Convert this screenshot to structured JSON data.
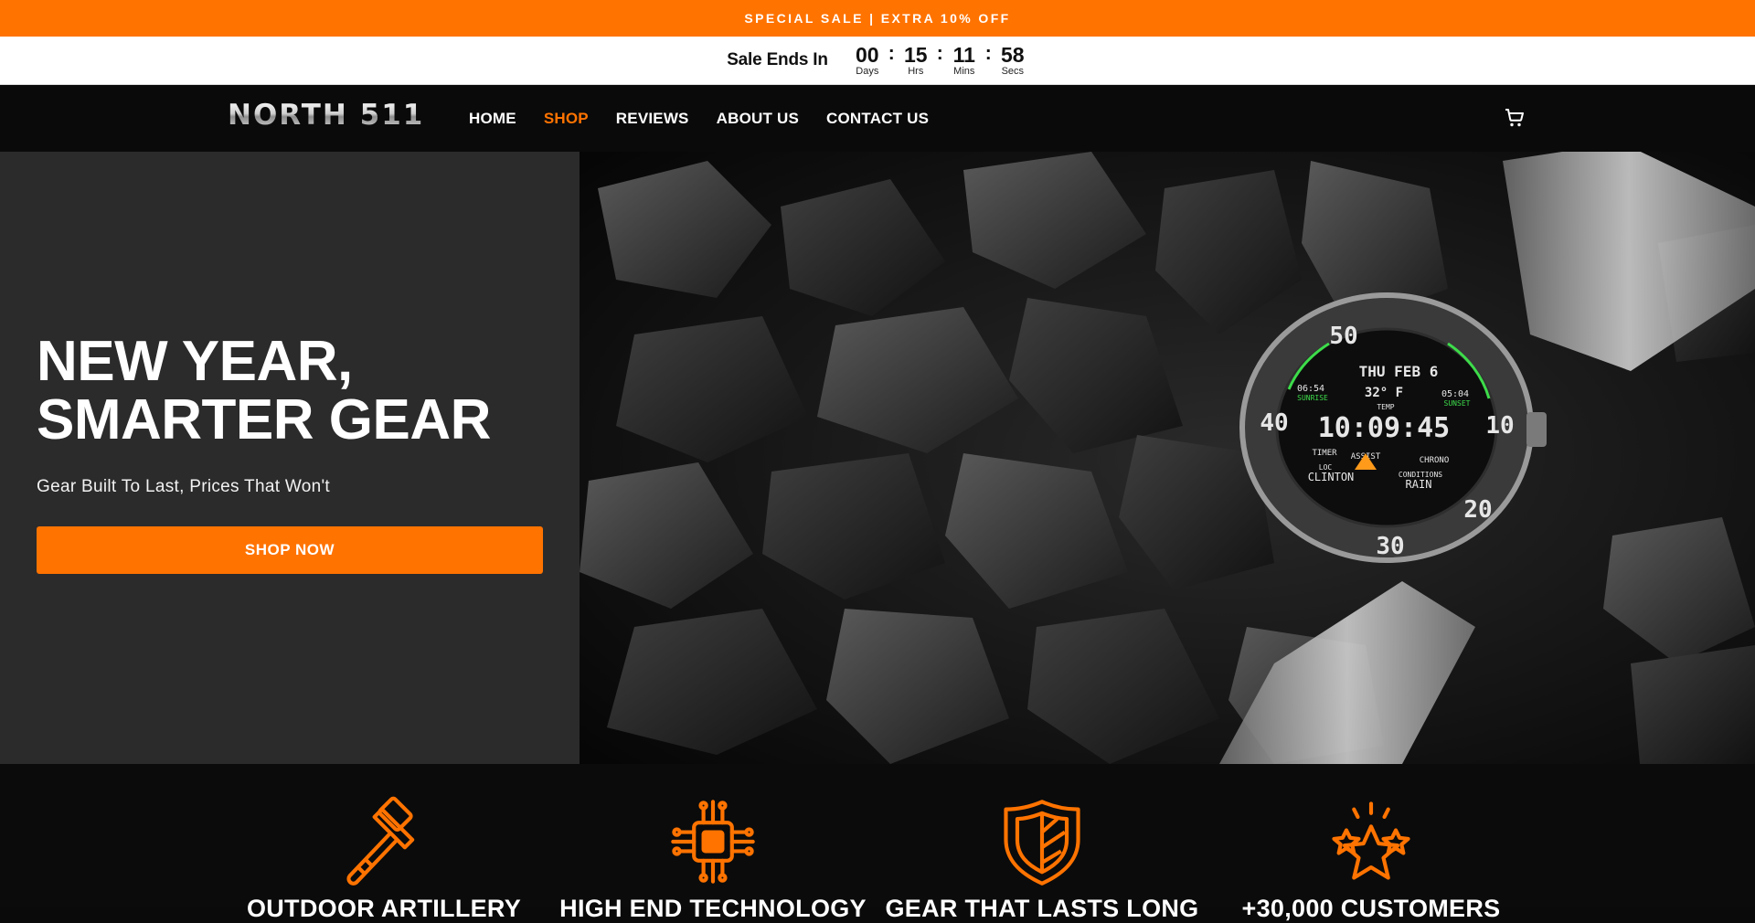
{
  "announcement": "SPECIAL SALE | EXTRA 10% OFF",
  "countdown": {
    "label": "Sale Ends In",
    "days": "00",
    "days_label": "Days",
    "hours": "15",
    "hours_label": "Hrs",
    "mins": "11",
    "mins_label": "Mins",
    "secs": "58",
    "secs_label": "Secs",
    "separator": ":"
  },
  "nav": {
    "logo": "NORTH 511",
    "items": [
      {
        "label": "HOME"
      },
      {
        "label": "SHOP",
        "active": true
      },
      {
        "label": "REVIEWS"
      },
      {
        "label": "ABOUT US"
      },
      {
        "label": "CONTACT US"
      }
    ],
    "cart_icon": "cart-icon"
  },
  "hero": {
    "title_line1": "NEW YEAR,",
    "title_line2": "SMARTER GEAR",
    "subtitle": "Gear Built To Last, Prices That Won't",
    "cta": "SHOP NOW",
    "watch_face": {
      "date": "THU FEB 6",
      "sunrise": "06:54",
      "sunrise_label": "SUNRISE",
      "temp": "32° F",
      "temp_label": "TEMP",
      "sunset": "05:04",
      "sunset_label": "SUNSET",
      "time": "10:09:45",
      "timer": "TIMER",
      "assist": "ASSIST",
      "chrono": "CHRONO",
      "loc": "LOC",
      "city": "CLINTON",
      "conditions": "CONDITIONS",
      "weather": "RAIN",
      "bezel": [
        "50",
        "10",
        "20",
        "30",
        "40"
      ]
    }
  },
  "features": [
    {
      "icon": "hammer-icon",
      "title": "OUTDOOR ARTILLERY"
    },
    {
      "icon": "chip-icon",
      "title": "HIGH END TECHNOLOGY"
    },
    {
      "icon": "shield-icon",
      "title": "GEAR THAT LASTS LONG"
    },
    {
      "icon": "stars-icon",
      "title": "+30,000 CUSTOMERS"
    }
  ],
  "colors": {
    "accent": "#ff7300",
    "nav_bg": "#0a0a0a",
    "hero_panel": "#2b2b2b"
  }
}
